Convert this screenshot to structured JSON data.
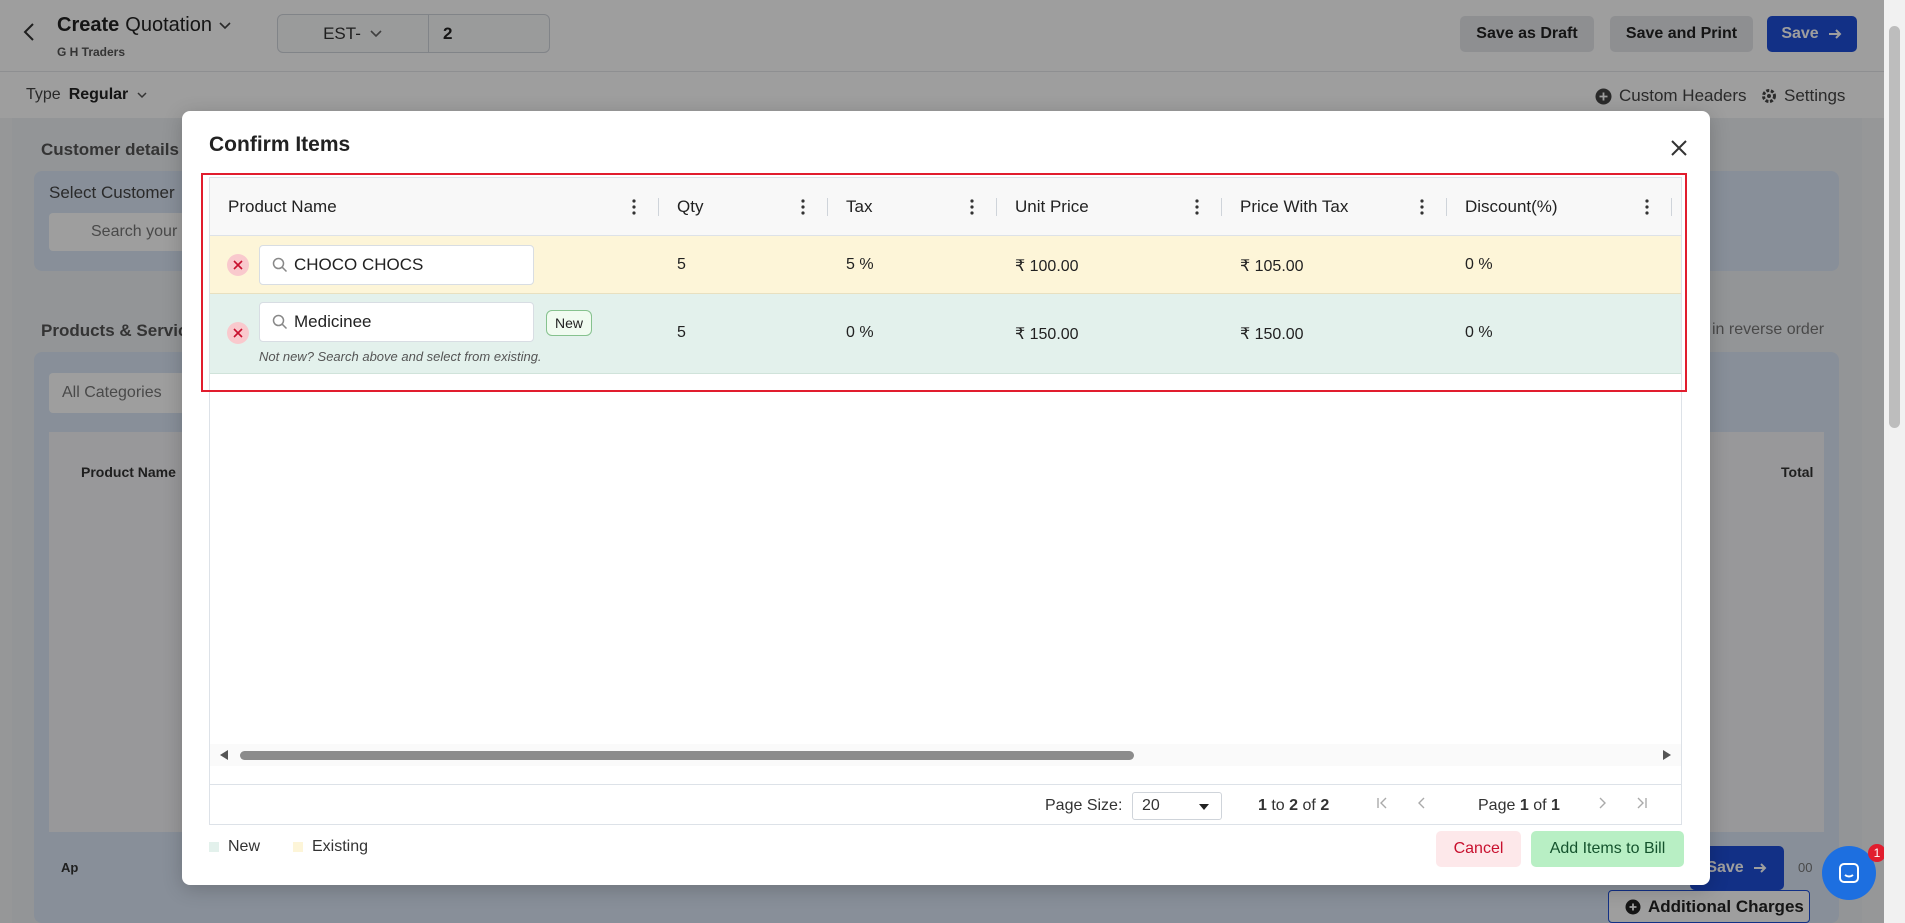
{
  "header": {
    "title_bold": "Create",
    "title_regular": "Quotation",
    "company": "G H Traders",
    "est_prefix": "EST-",
    "est_number": "2",
    "save_draft_label": "Save as Draft",
    "save_print_label": "Save and Print",
    "save_label": "Save"
  },
  "typebar": {
    "type_label": "Type",
    "type_value": "Regular",
    "custom_headers_label": "Custom Headers",
    "settings_label": "Settings"
  },
  "background": {
    "customer_details": "Customer details",
    "select_customer": "Select Customer",
    "search_placeholder": "Search your",
    "products_services": "Products & Service",
    "reverse_order": "in reverse order",
    "all_categories": "All Categories",
    "product_name_col": "Product Name",
    "total_col": "Total",
    "additional_charges": "Additional Charges",
    "bottom_save": "Save",
    "bottom_left_partial": "Ap",
    "bottom_right_partial": "00"
  },
  "modal": {
    "title": "Confirm Items",
    "columns": [
      "Product Name",
      "Qty",
      "Tax",
      "Unit Price",
      "Price With Tax",
      "Discount(%)"
    ],
    "rows": [
      {
        "status": "existing",
        "product": "CHOCO CHOCS",
        "qty": "5",
        "tax": "5 %",
        "unit_price": "₹ 100.00",
        "price_with_tax": "₹ 105.00",
        "discount": "0 %"
      },
      {
        "status": "new",
        "product": "Medicinee",
        "new_tag": "New",
        "hint": "Not new? Search above and select from existing.",
        "qty": "5",
        "tax": "0 %",
        "unit_price": "₹ 150.00",
        "price_with_tax": "₹ 150.00",
        "discount": "0 %"
      }
    ],
    "pager": {
      "page_size_label": "Page Size:",
      "page_size_value": "20",
      "range_from": "1",
      "range_to_word": "to",
      "range_to": "2",
      "range_of_word": "of",
      "range_total": "2",
      "page_word": "Page",
      "page_current": "1",
      "page_of_word": "of",
      "page_total": "1"
    },
    "legend_new": "New",
    "legend_existing": "Existing",
    "cancel_label": "Cancel",
    "add_label": "Add Items to Bill"
  },
  "chat_badge": "1",
  "colors": {
    "accent": "#1d4ed8",
    "existing_row": "#fdf5d8",
    "new_row": "#e3f1ec",
    "highlight": "#e11d2e"
  }
}
